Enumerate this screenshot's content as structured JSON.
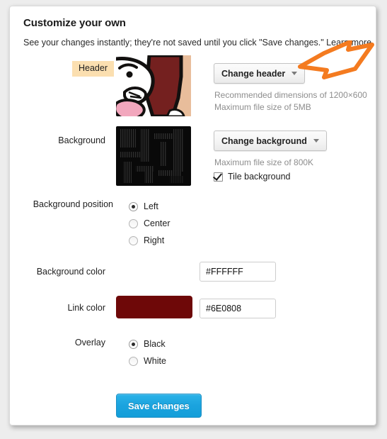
{
  "panel": {
    "title": "Customize your own",
    "description_prefix": "See your changes instantly; they're not saved until you click \"Save changes.\" ",
    "learn_more": "Learn more."
  },
  "header_section": {
    "label": "Header",
    "button_label": "Change header",
    "hint_dimensions": "Recommended dimensions of 1200×600",
    "hint_filesize": "Maximum file size of 5MB"
  },
  "background_section": {
    "label": "Background",
    "button_label": "Change background",
    "hint_filesize": "Maximum file size of 800K",
    "tile_label": "Tile background",
    "tile_checked": true
  },
  "background_position": {
    "label": "Background position",
    "options": [
      {
        "label": "Left",
        "selected": true
      },
      {
        "label": "Center",
        "selected": false
      },
      {
        "label": "Right",
        "selected": false
      }
    ]
  },
  "background_color": {
    "label": "Background color",
    "value": "#FFFFFF"
  },
  "link_color": {
    "label": "Link color",
    "value": "#6E0808",
    "swatch": "#6E0808"
  },
  "overlay": {
    "label": "Overlay",
    "options": [
      {
        "label": "Black",
        "selected": true
      },
      {
        "label": "White",
        "selected": false
      }
    ]
  },
  "actions": {
    "save_label": "Save changes"
  },
  "colors": {
    "accent_blue": "#1BA3DE",
    "annotation_orange": "#F47B20",
    "highlight_peach": "#FBDFB0",
    "link_swatch": "#6E0808"
  }
}
